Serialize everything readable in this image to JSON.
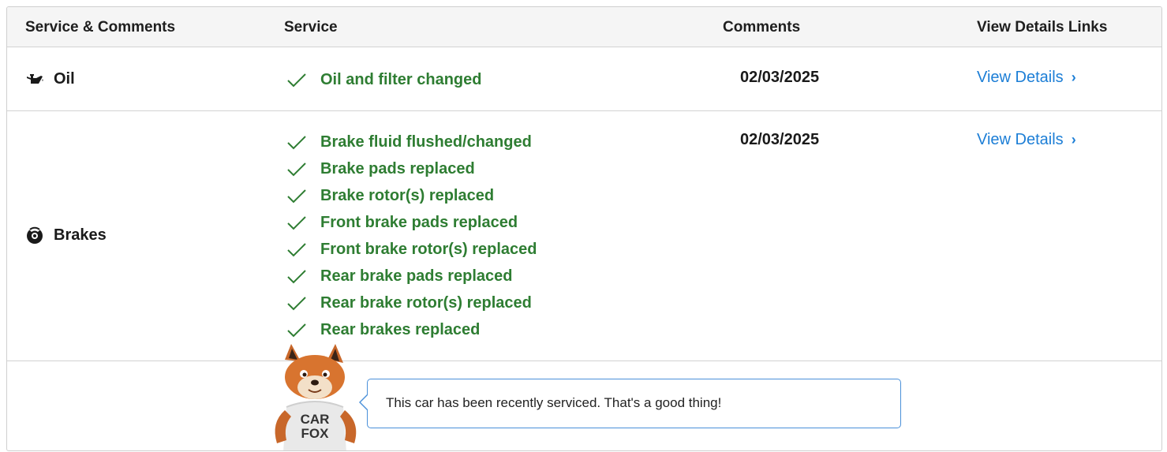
{
  "table": {
    "headers": [
      "Service & Comments",
      "Service",
      "Comments",
      "View Details Links"
    ]
  },
  "rows": [
    {
      "category": "Oil",
      "icon": "oil-can-icon",
      "services": [
        "Oil and filter changed"
      ],
      "date": "02/03/2025",
      "link": "View Details"
    },
    {
      "category": "Brakes",
      "icon": "brake-disc-icon",
      "services": [
        "Brake fluid flushed/changed",
        "Brake pads replaced",
        "Brake rotor(s) replaced",
        "Front brake pads replaced",
        "Front brake rotor(s) replaced",
        "Rear brake pads replaced",
        "Rear brake rotor(s) replaced",
        "Rear brakes replaced"
      ],
      "date": "02/03/2025",
      "link": "View Details"
    }
  ],
  "mascot": {
    "shirt_line1": "CAR",
    "shirt_line2": "FOX",
    "message": "This car has been recently serviced. That's a good thing!"
  },
  "colors": {
    "service_green": "#2e7d32",
    "link_blue": "#1c7ed6",
    "bubble_border": "#4a90d9"
  }
}
